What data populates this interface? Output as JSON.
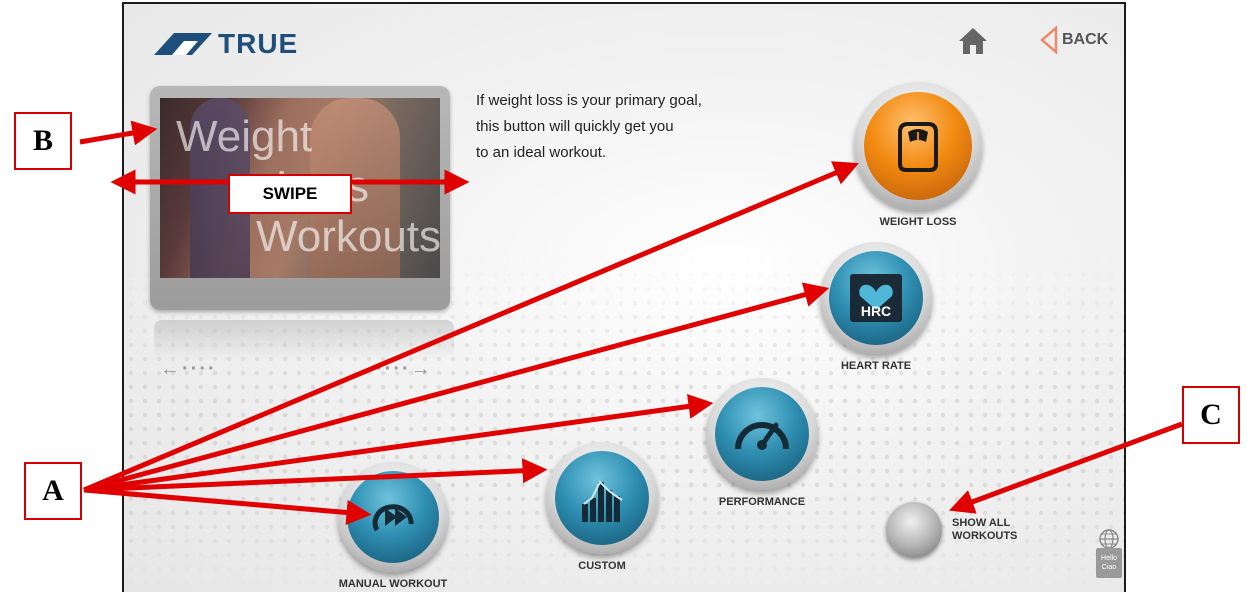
{
  "header": {
    "brand": "TRUE",
    "home_icon": "home-icon",
    "back_label": "BACK",
    "back_icon": "back-arrow-icon"
  },
  "video": {
    "title_lines": [
      "Weight",
      "Loss",
      "Workouts"
    ]
  },
  "description": {
    "lines": [
      "If weight loss is your primary goal,",
      "this button will quickly get you",
      "to an ideal workout."
    ]
  },
  "swipe": {
    "left_hint": "←····",
    "right_hint": "····→"
  },
  "workouts": {
    "weight_loss": "WEIGHT LOSS",
    "heart_rate": "HEART RATE",
    "heart_rate_badge": "HRC",
    "performance": "PERFORMANCE",
    "custom": "CUSTOM",
    "manual": "MANUAL WORKOUT"
  },
  "show_all": {
    "line1": "SHOW ALL",
    "line2": "WORKOUTS"
  },
  "language": {
    "line1": "Hello",
    "line2": "Ciao",
    "icon": "globe-icon"
  },
  "callouts": {
    "a": "A",
    "b": "B",
    "c": "C",
    "swipe": "SWIPE"
  },
  "colors": {
    "annotation_red": "#e00000",
    "accent_orange": "#f28a10",
    "accent_teal": "#2f8fb2",
    "brand_blue": "#1e4f7a"
  }
}
